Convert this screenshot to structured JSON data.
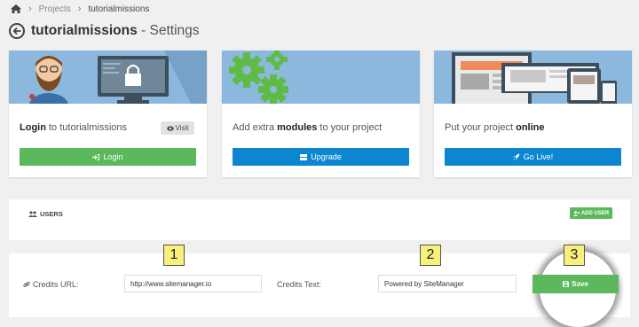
{
  "breadcrumb": {
    "projects": "Projects",
    "current": "tutorialmissions"
  },
  "page": {
    "title": "tutorialmissions",
    "subtitle": " - Settings"
  },
  "cards": [
    {
      "caption_bold": "Login",
      "caption_rest": " to tutorialmissions",
      "visit_label": "Visit",
      "button_label": "Login"
    },
    {
      "caption_pre": "Add extra ",
      "caption_bold": "modules",
      "caption_post": " to your project",
      "button_label": "Upgrade"
    },
    {
      "caption_pre": "Put your project ",
      "caption_bold": "online",
      "button_label": "Go Live!"
    }
  ],
  "users": {
    "label": "USERS",
    "add_label": "ADD USER"
  },
  "credits": {
    "url_label": "Credits URL:",
    "url_value": "http://www.sitemanager.io",
    "text_label": "Credits Text:",
    "text_value": "Powered by SiteManager",
    "save_label": "Save"
  },
  "callouts": [
    "1",
    "2",
    "3"
  ],
  "colors": {
    "green": "#5cb85c",
    "blue": "#0c86d1",
    "banner": "#8cb8dd",
    "callout": "#f7f07a"
  }
}
